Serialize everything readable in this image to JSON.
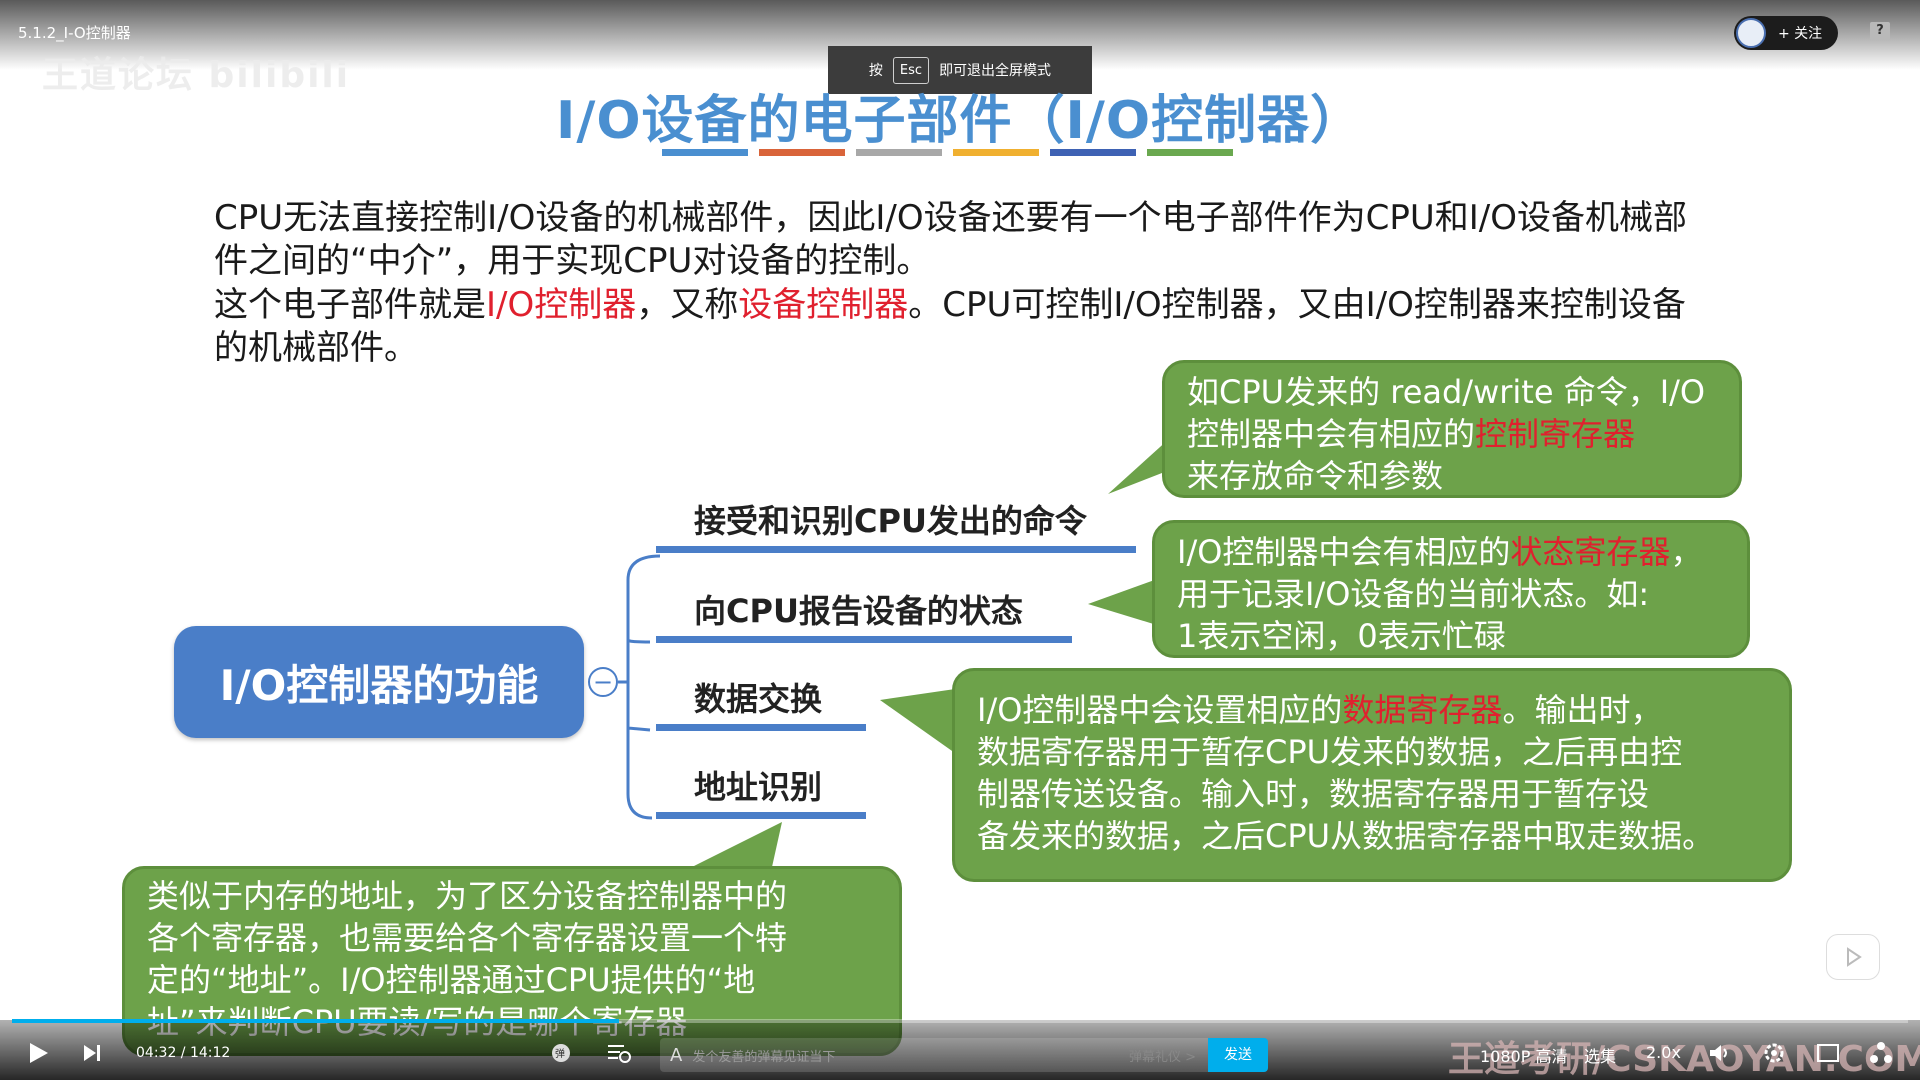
{
  "video": {
    "title": "5.1.2_I-O控制器",
    "watermark": "王道论坛 bilibili",
    "esc_pre": "按",
    "esc_key": "Esc",
    "esc_post": "即可退出全屏模式",
    "follow": "+ 关注",
    "help": "?"
  },
  "slide": {
    "title": "I/O设备的电子部件（I/O控制器）",
    "bar_colors": [
      "#4a8fd0",
      "#d9643a",
      "#a8a8a8",
      "#f0b030",
      "#3e62b4",
      "#6aa84f"
    ],
    "para1_line1": "CPU无法直接控制I/O设备的机械部件，因此I/O设备还要有一个电子部件作为CPU和I/O设备机械部",
    "para1_line2": "件之间的“中介”，用于实现CPU对设备的控制。",
    "para2_a": "这个电子部件就是",
    "para2_red1": "I/O控制器",
    "para2_b": "，又称",
    "para2_red2": "设备控制器",
    "para2_c": "。CPU可控制I/O控制器，又由I/O控制器来控制设备",
    "para2_line2": "的机械部件。",
    "root": "I/O控制器的功能",
    "collapse": "−",
    "branches": [
      "接受和识别CPU发出的命令",
      "向CPU报告设备的状态",
      "数据交换",
      "地址识别"
    ],
    "callout1": {
      "l1": "如CPU发来的 read/write 命令，I/O",
      "l2a": "控制器中会有相应的",
      "l2red": "控制寄存器",
      "l3": "来存放命令和参数"
    },
    "callout2": {
      "l1a": "I/O控制器中会有相应的",
      "l1red": "状态寄存器",
      "l1b": "，",
      "l2": "用于记录I/O设备的当前状态。如:",
      "l3": "1表示空闲，0表示忙碌"
    },
    "callout3": {
      "l1a": "I/O控制器中会设置相应的",
      "l1red": "数据寄存器",
      "l1b": "。输出时，",
      "l2": "数据寄存器用于暂存CPU发来的数据，之后再由控",
      "l3": "制器传送设备。输入时，数据寄存器用于暂存设",
      "l4": "备发来的数据，之后CPU从数据寄存器中取走数据。"
    },
    "callout4": {
      "l1": "类似于内存的地址，为了区分设备控制器中的",
      "l2": "各个寄存器，也需要给各个寄存器设置一个特",
      "l3": "定的“地址”。I/O控制器通过CPU提供的“地",
      "l4": "址”来判断CPU要读/写的是哪个寄存器"
    }
  },
  "player": {
    "progress": 0.32,
    "time": "04:32 / 14:12",
    "danmu_placeholder": "发个友善的弹幕见证当下",
    "danmu_etiquette": "弹幕礼仪 >",
    "send": "发送",
    "quality": "1080P 高清",
    "episodes": "选集",
    "speed": "2.0x",
    "brand_watermark": "王道考研/CSKAOYAN.COM",
    "accent": "#00aeec"
  }
}
